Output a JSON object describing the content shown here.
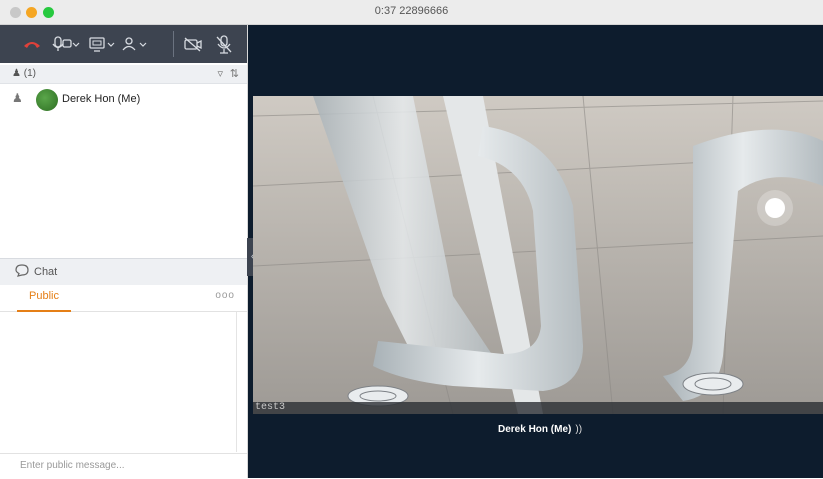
{
  "window": {
    "title": "0:37  22896666"
  },
  "toolbar": {
    "end_call": "☎",
    "audio": "⚲⌄",
    "share": "⧉⌄",
    "participants": "♙⌄",
    "video_off": "⊘",
    "mute": "♆"
  },
  "participants": {
    "count_label": "(1)",
    "filter_icon": "filter-icon",
    "sort_icon": "sort-icon",
    "items": [
      {
        "name": "Derek Hon (Me)"
      }
    ]
  },
  "chat": {
    "header_label": "Chat",
    "tabs": [
      {
        "label": "Public"
      }
    ],
    "more_label": "ooo",
    "input_placeholder": "Enter public message..."
  },
  "video": {
    "label": "test3",
    "speaker_name": "Derek Hon (Me)"
  },
  "colors": {
    "toolbar_bg": "#3d4450",
    "accent": "#e57f17",
    "video_bg": "#0d1c2d"
  }
}
